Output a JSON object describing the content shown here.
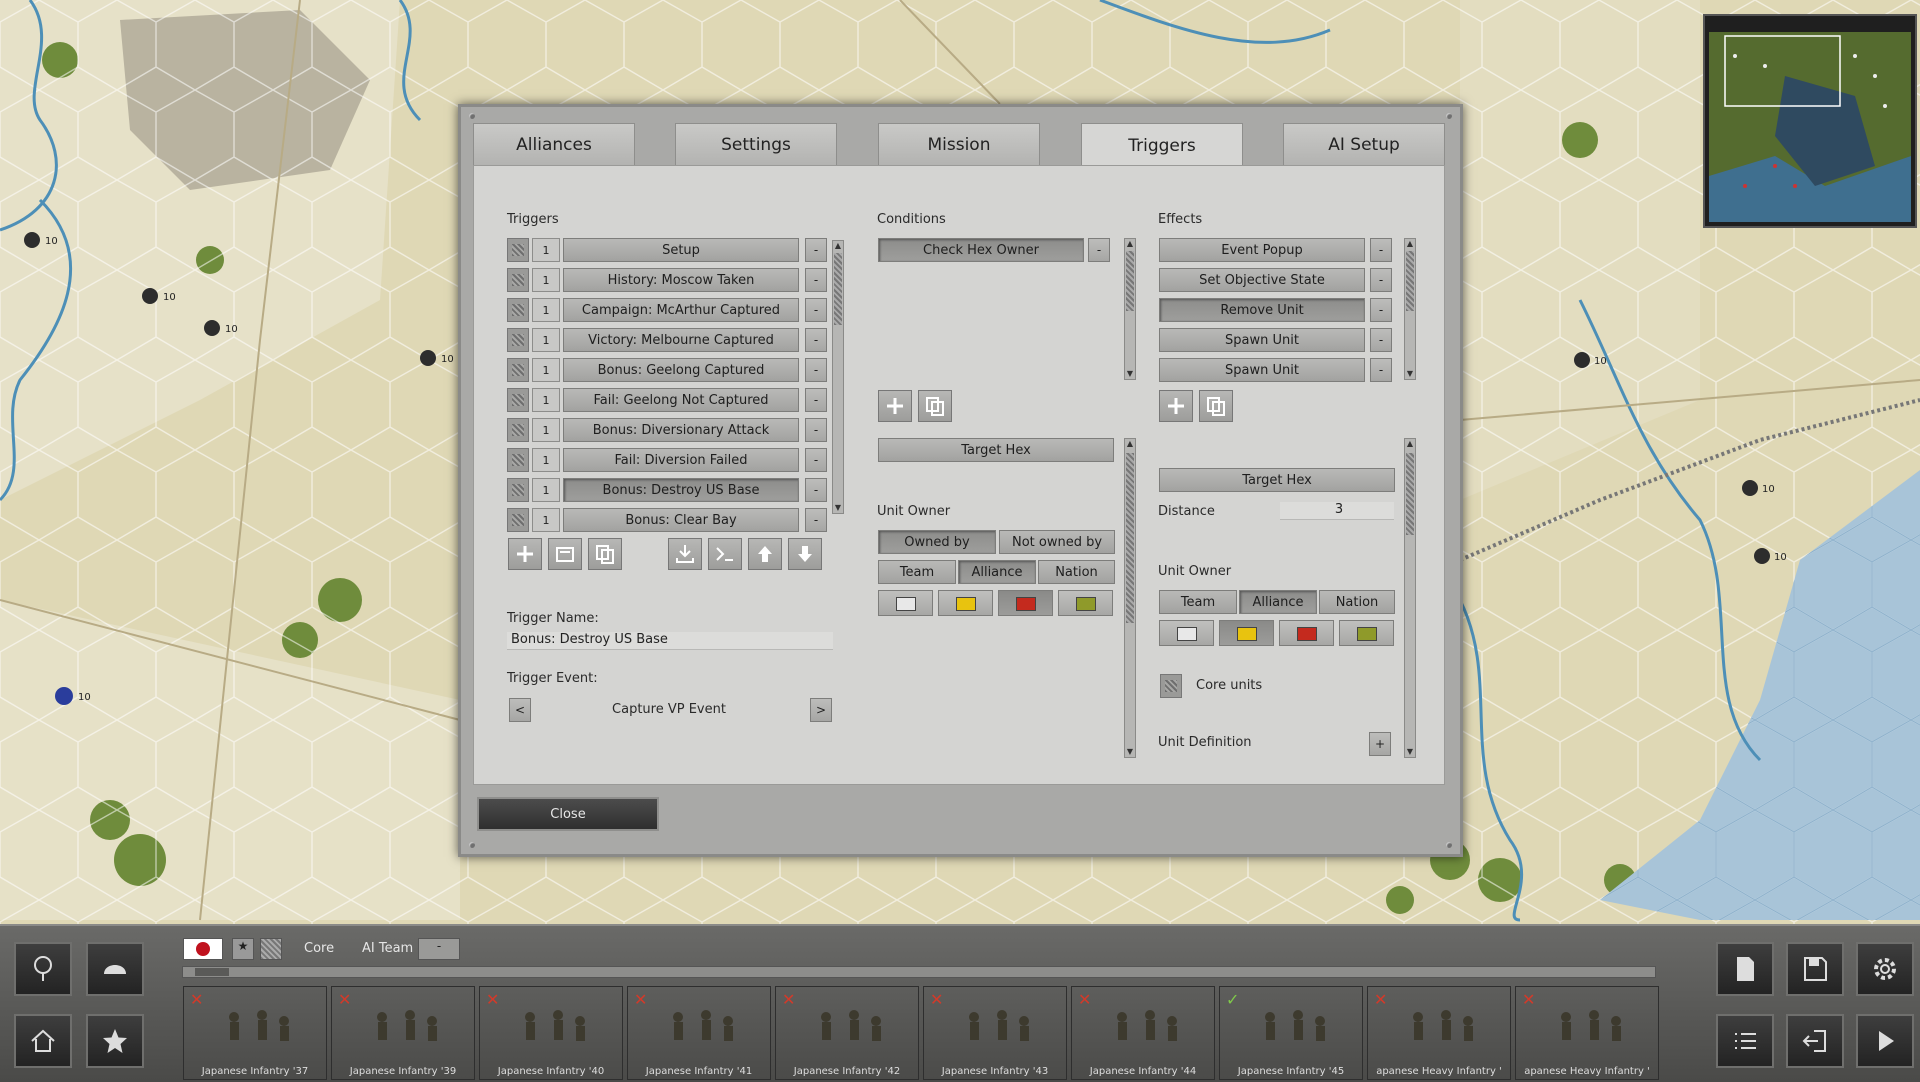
{
  "tabs": [
    "Alliances",
    "Settings",
    "Mission",
    "Triggers",
    "AI Setup"
  ],
  "active_tab": "Triggers",
  "triggers": {
    "label": "Triggers",
    "items": [
      {
        "num": "1",
        "name": "Setup"
      },
      {
        "num": "1",
        "name": "History: Moscow Taken"
      },
      {
        "num": "1",
        "name": "Campaign: McArthur Captured"
      },
      {
        "num": "1",
        "name": "Victory: Melbourne Captured"
      },
      {
        "num": "1",
        "name": "Bonus: Geelong Captured"
      },
      {
        "num": "1",
        "name": "Fail: Geelong Not Captured"
      },
      {
        "num": "1",
        "name": "Bonus: Diversionary Attack"
      },
      {
        "num": "1",
        "name": "Fail: Diversion Failed"
      },
      {
        "num": "1",
        "name": "Bonus: Destroy US Base"
      },
      {
        "num": "1",
        "name": "Bonus: Clear Bay"
      }
    ],
    "remove_label": "-",
    "selected_index": 8,
    "trigger_name_label": "Trigger Name:",
    "trigger_name_value": "Bonus: Destroy US Base",
    "trigger_event_label": "Trigger Event:",
    "trigger_event_value": "Capture VP Event",
    "prev_label": "<",
    "next_label": ">"
  },
  "conditions": {
    "label": "Conditions",
    "items": [
      "Check Hex Owner"
    ],
    "remove_label": "-",
    "target_hex_label": "Target Hex",
    "unit_owner_label": "Unit Owner",
    "owned_by_label": "Owned by",
    "not_owned_by_label": "Not owned by",
    "team_label": "Team",
    "alliance_label": "Alliance",
    "nation_label": "Nation",
    "selected_color": "red"
  },
  "effects": {
    "label": "Effects",
    "items": [
      "Event Popup",
      "Set Objective State",
      "Remove Unit",
      "Spawn Unit",
      "Spawn Unit"
    ],
    "selected_index": 2,
    "remove_label": "-",
    "target_hex_label": "Target Hex",
    "distance_label": "Distance",
    "distance_value": "3",
    "unit_owner_label": "Unit Owner",
    "team_label": "Team",
    "alliance_label": "Alliance",
    "nation_label": "Nation",
    "selected_color": "yellow",
    "core_units_label": "Core units",
    "unit_definition_label": "Unit Definition",
    "add_label": "+"
  },
  "colors": {
    "white": "#e8e8e8",
    "yellow": "#e8c30f",
    "red": "#c42a1e",
    "olive": "#8f9a2a"
  },
  "close_label": "Close",
  "bottom_bar": {
    "core_label": "Core",
    "ai_team_label": "AI Team",
    "ai_team_value": "-",
    "units": [
      {
        "name": "Japanese Infantry '37",
        "status": "x"
      },
      {
        "name": "Japanese Infantry '39",
        "status": "x"
      },
      {
        "name": "Japanese Infantry '40",
        "status": "x"
      },
      {
        "name": "Japanese Infantry '41",
        "status": "x"
      },
      {
        "name": "Japanese Infantry '42",
        "status": "x"
      },
      {
        "name": "Japanese Infantry '43",
        "status": "x"
      },
      {
        "name": "Japanese Infantry '44",
        "status": "x"
      },
      {
        "name": "Japanese Infantry '45",
        "status": "check"
      },
      {
        "name": "apanese Heavy Infantry '",
        "status": "x"
      },
      {
        "name": "apanese Heavy Infantry '",
        "status": "x"
      }
    ]
  },
  "map_unit_labels": [
    "10",
    "10",
    "10",
    "10",
    "10",
    "10",
    "10",
    "10"
  ]
}
